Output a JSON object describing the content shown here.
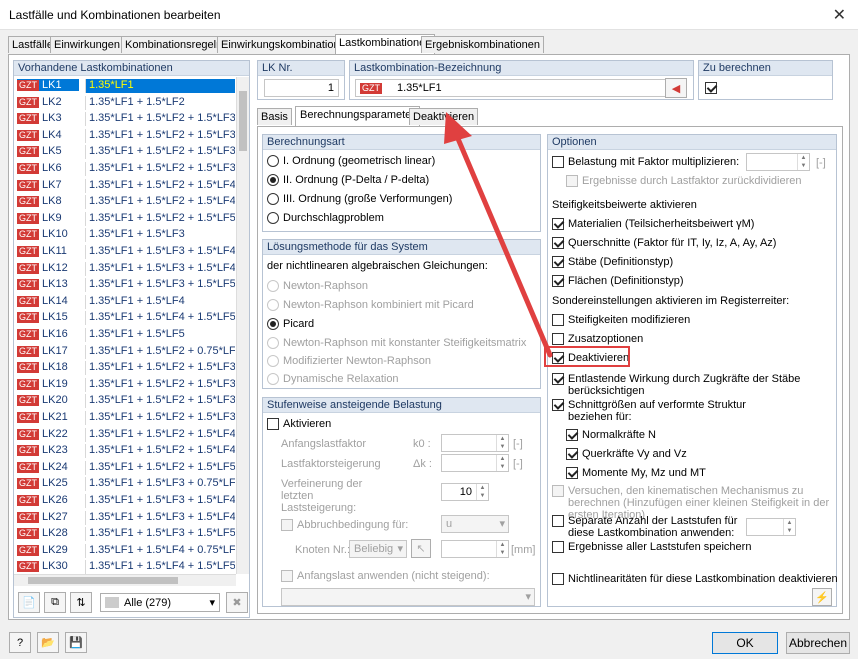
{
  "window": {
    "title": "Lastfälle und Kombinationen bearbeiten",
    "close_icon": "close-icon"
  },
  "tabs": [
    "Lastfälle",
    "Einwirkungen",
    "Kombinationsregeln",
    "Einwirkungskombinationen",
    "Lastkombinationen",
    "Ergebniskombinationen"
  ],
  "active_tab": "Lastkombinationen",
  "left": {
    "header": "Vorhandene Lastkombinationen",
    "filter_value": "Alle (279)",
    "rows": [
      {
        "tag": "GZT",
        "id": "LK1",
        "desc": "1.35*LF1"
      },
      {
        "tag": "GZT",
        "id": "LK2",
        "desc": "1.35*LF1 + 1.5*LF2"
      },
      {
        "tag": "GZT",
        "id": "LK3",
        "desc": "1.35*LF1 + 1.5*LF2 + 1.5*LF3"
      },
      {
        "tag": "GZT",
        "id": "LK4",
        "desc": "1.35*LF1 + 1.5*LF2 + 1.5*LF3 + 1"
      },
      {
        "tag": "GZT",
        "id": "LK5",
        "desc": "1.35*LF1 + 1.5*LF2 + 1.5*LF3 + 1"
      },
      {
        "tag": "GZT",
        "id": "LK6",
        "desc": "1.35*LF1 + 1.5*LF2 + 1.5*LF3 + 1"
      },
      {
        "tag": "GZT",
        "id": "LK7",
        "desc": "1.35*LF1 + 1.5*LF2 + 1.5*LF4"
      },
      {
        "tag": "GZT",
        "id": "LK8",
        "desc": "1.35*LF1 + 1.5*LF2 + 1.5*LF4 + 1"
      },
      {
        "tag": "GZT",
        "id": "LK9",
        "desc": "1.35*LF1 + 1.5*LF2 + 1.5*LF5"
      },
      {
        "tag": "GZT",
        "id": "LK10",
        "desc": "1.35*LF1 + 1.5*LF3"
      },
      {
        "tag": "GZT",
        "id": "LK11",
        "desc": "1.35*LF1 + 1.5*LF3 + 1.5*LF4"
      },
      {
        "tag": "GZT",
        "id": "LK12",
        "desc": "1.35*LF1 + 1.5*LF3 + 1.5*LF4 + 1"
      },
      {
        "tag": "GZT",
        "id": "LK13",
        "desc": "1.35*LF1 + 1.5*LF3 + 1.5*LF5"
      },
      {
        "tag": "GZT",
        "id": "LK14",
        "desc": "1.35*LF1 + 1.5*LF4"
      },
      {
        "tag": "GZT",
        "id": "LK15",
        "desc": "1.35*LF1 + 1.5*LF4 + 1.5*LF5"
      },
      {
        "tag": "GZT",
        "id": "LK16",
        "desc": "1.35*LF1 + 1.5*LF5"
      },
      {
        "tag": "GZT",
        "id": "LK17",
        "desc": "1.35*LF1 + 1.5*LF2 + 0.75*LF6"
      },
      {
        "tag": "GZT",
        "id": "LK18",
        "desc": "1.35*LF1 + 1.5*LF2 + 1.5*LF3 + 0"
      },
      {
        "tag": "GZT",
        "id": "LK19",
        "desc": "1.35*LF1 + 1.5*LF2 + 1.5*LF3 + 1"
      },
      {
        "tag": "GZT",
        "id": "LK20",
        "desc": "1.35*LF1 + 1.5*LF2 + 1.5*LF3 + 1"
      },
      {
        "tag": "GZT",
        "id": "LK21",
        "desc": "1.35*LF1 + 1.5*LF2 + 1.5*LF3 + 1"
      },
      {
        "tag": "GZT",
        "id": "LK22",
        "desc": "1.35*LF1 + 1.5*LF2 + 1.5*LF4 + 0"
      },
      {
        "tag": "GZT",
        "id": "LK23",
        "desc": "1.35*LF1 + 1.5*LF2 + 1.5*LF4 + 1"
      },
      {
        "tag": "GZT",
        "id": "LK24",
        "desc": "1.35*LF1 + 1.5*LF2 + 1.5*LF5 + 0"
      },
      {
        "tag": "GZT",
        "id": "LK25",
        "desc": "1.35*LF1 + 1.5*LF3 + 0.75*LF6"
      },
      {
        "tag": "GZT",
        "id": "LK26",
        "desc": "1.35*LF1 + 1.5*LF3 + 1.5*LF4 + 0"
      },
      {
        "tag": "GZT",
        "id": "LK27",
        "desc": "1.35*LF1 + 1.5*LF3 + 1.5*LF4 + 1"
      },
      {
        "tag": "GZT",
        "id": "LK28",
        "desc": "1.35*LF1 + 1.5*LF3 + 1.5*LF5 + 0"
      },
      {
        "tag": "GZT",
        "id": "LK29",
        "desc": "1.35*LF1 + 1.5*LF4 + 0.75*LF6"
      },
      {
        "tag": "GZT",
        "id": "LK30",
        "desc": "1.35*LF1 + 1.5*LF4 + 1.5*LF5 + 0"
      }
    ]
  },
  "lk_nr": {
    "label": "LK Nr.",
    "value": "1"
  },
  "bez": {
    "label": "Lastkombination-Bezeichnung",
    "tag": "GZT",
    "value": "1.35*LF1"
  },
  "zu_berechnen": {
    "label": "Zu berechnen"
  },
  "subtabs": [
    "Basis",
    "Berechnungsparameter",
    "Deaktivieren"
  ],
  "berechnungsart": {
    "header": "Berechnungsart",
    "options": [
      "I. Ordnung (geometrisch linear)",
      "II. Ordnung (P-Delta / P-delta)",
      "III. Ordnung (große Verformungen)",
      "Durchschlagproblem"
    ]
  },
  "loesung": {
    "header": "Lösungsmethode für das System",
    "desc": "der nichtlinearen algebraischen Gleichungen:",
    "options": [
      "Newton-Raphson",
      "Newton-Raphson kombiniert mit Picard",
      "Picard",
      "Newton-Raphson mit konstanter Steifigkeitsmatrix",
      "Modifizierter Newton-Raphson",
      "Dynamische Relaxation"
    ]
  },
  "stufen": {
    "header": "Stufenweise ansteigende Belastung",
    "aktivieren": "Aktivieren",
    "anfang": "Anfangslastfaktor",
    "anfang_sym": "k0 :",
    "steig": "Lastfaktorsteigerung",
    "steig_sym": "Δk :",
    "verf": "Verfeinerung der letzten Laststeigerung:",
    "verf_value": "10",
    "abbruch": "Abbruchbedingung für:",
    "abbruch_val": "u",
    "knoten": "Knoten Nr.:",
    "knoten_val": "Beliebig",
    "unit": "[-]",
    "unit_mm": "[mm]",
    "anfangslast": "Anfangslast anwenden (nicht steigend):"
  },
  "optionen": {
    "header": "Optionen",
    "faktor": "Belastung mit Faktor multiplizieren:",
    "faktor_unit": "[-]",
    "ergeb": "Ergebnisse durch Lastfaktor zurückdividieren",
    "steif_head": "Steifigkeitsbeiwerte aktivieren",
    "materialien": "Materialien (Teilsicherheitsbeiwert γM)",
    "querschnitte": "Querschnitte (Faktor für IT, Iy, Iz, A, Ay, Az)",
    "staebe": "Stäbe (Definitionstyp)",
    "flaechen": "Flächen (Definitionstyp)",
    "sonder_head": "Sondereinstellungen aktivieren im Registerreiter:",
    "steif_mod": "Steifigkeiten modifizieren",
    "zusatz": "Zusatzoptionen",
    "deakt": "Deaktivieren",
    "entlast": "Entlastende Wirkung durch Zugkräfte der Stäbe berücksichtigen",
    "schnitt": "Schnittgrößen auf verformte Struktur beziehen für:",
    "normal": "Normalkräfte N",
    "quer": "Querkräfte Vy and Vz",
    "momente": "Momente My, Mz und MT",
    "versuch": "Versuchen, den kinematischen Mechanismus zu berechnen (Hinzufügen einer kleinen Steifigkeit in der ersten Iteration)",
    "separate": "Separate Anzahl der Laststufen für diese Lastkombination anwenden:",
    "alle_stufen": "Ergebnisse aller Laststufen speichern",
    "nichtlin": "Nichtlinearitäten für diese Lastkombination deaktivieren"
  },
  "buttons": {
    "ok": "OK",
    "cancel": "Abbrechen"
  },
  "colors": {
    "selection": "#0078d7",
    "gzt": "#d23a36",
    "arrow": "#e04040",
    "group_header": "#dfe7f1"
  }
}
